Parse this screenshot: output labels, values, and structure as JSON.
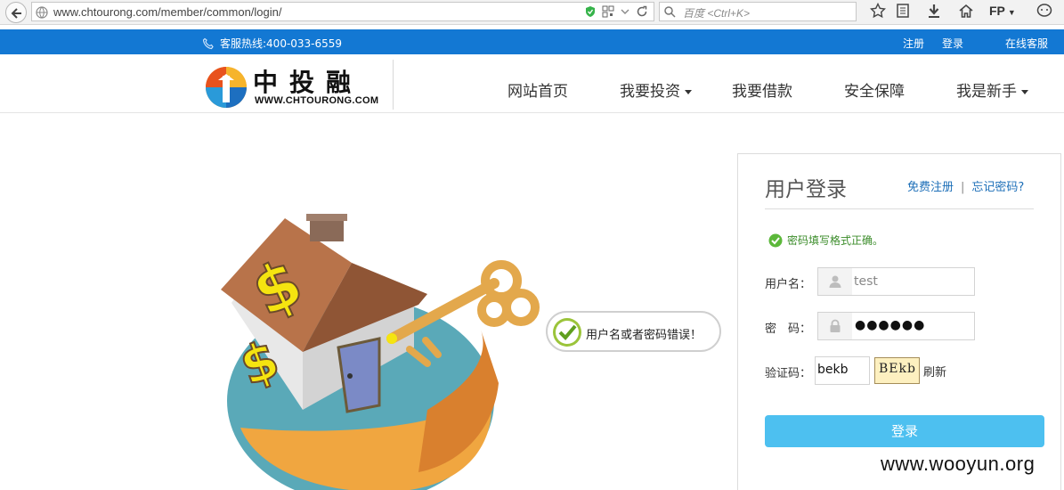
{
  "browser": {
    "url": "www.chtourong.com/member/common/login/",
    "search_placeholder": "百度 <Ctrl+K>",
    "toolbar_icons": [
      "star-icon",
      "reading-list-icon",
      "download-icon",
      "home-icon",
      "fp-menu-icon",
      "chat-icon"
    ],
    "fp_label": "FP"
  },
  "topbar": {
    "hotline": "客服热线:400-033-6559",
    "register": "注册",
    "login": "登录",
    "online_service": "在线客服",
    "color": "#1378d3"
  },
  "header": {
    "logo_text": "中投融",
    "logo_sub": "WWW.CHTOURONG.COM",
    "nav": [
      "网站首页",
      "我要投资",
      "我要借款",
      "安全保障",
      "我是新手"
    ]
  },
  "hero": {
    "bubble_text": "用户名或者密码错误！"
  },
  "login_panel": {
    "title": "用户登录",
    "register_link": "免费注册",
    "divider": "|",
    "forgot_link": "忘记密码?",
    "status_msg": "密码填写格式正确。",
    "username_label": "用户名：",
    "username_value": "test",
    "password_label": "密　码：",
    "password_value": "●●●●●●",
    "captcha_label": "验证码：",
    "captcha_value": "bekb",
    "captcha_image_text": "BEkb",
    "refresh_label": "刷新",
    "submit_label": "登录",
    "accent": "#4dc0f0"
  },
  "watermark": "www.wooyun.org"
}
